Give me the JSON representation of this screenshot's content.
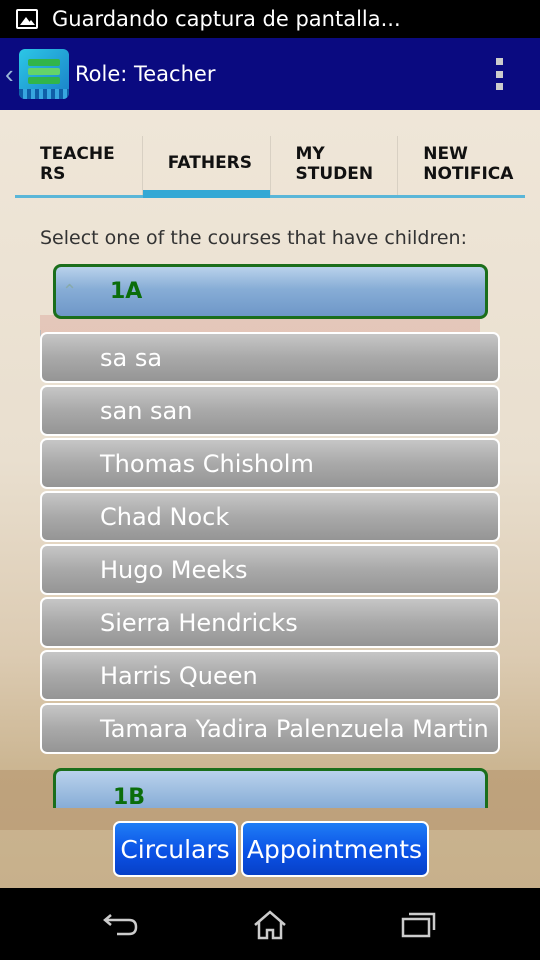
{
  "status_bar": {
    "icon": "image-icon",
    "text": "Guardando captura de pantalla..."
  },
  "action_bar": {
    "title": "Role: Teacher",
    "back_icon": "chevron-left-icon",
    "logo": "app-logo-icon",
    "menu_icon": "overflow-menu-icon"
  },
  "tabs": [
    {
      "label": "TEACHE\nRS"
    },
    {
      "label": "FATHERS",
      "active": true
    },
    {
      "label": "MY\nSTUDEN"
    },
    {
      "label": "NEW\nNOTIFICA"
    }
  ],
  "prompt": "Select one of the courses that have children:",
  "groups": [
    {
      "label": "1A",
      "expanded": true
    },
    {
      "label": "1B",
      "expanded": false
    }
  ],
  "children": [
    "sa sa",
    "san san",
    "Thomas Chisholm",
    "Chad Nock",
    "Hugo Meeks",
    "Sierra Hendricks",
    "Harris Queen",
    "Tamara Yadira Palenzuela Martin"
  ],
  "buttons": {
    "circulars": "Circulars",
    "appointments": "Appointments"
  },
  "nav": {
    "back": "back-icon",
    "home": "home-icon",
    "recent": "recent-apps-icon"
  },
  "colors": {
    "action_bar": "#0a0a80",
    "tab_indicator": "#33a8d5",
    "group_text": "#0b6d0b",
    "button": "#0b52e6"
  }
}
